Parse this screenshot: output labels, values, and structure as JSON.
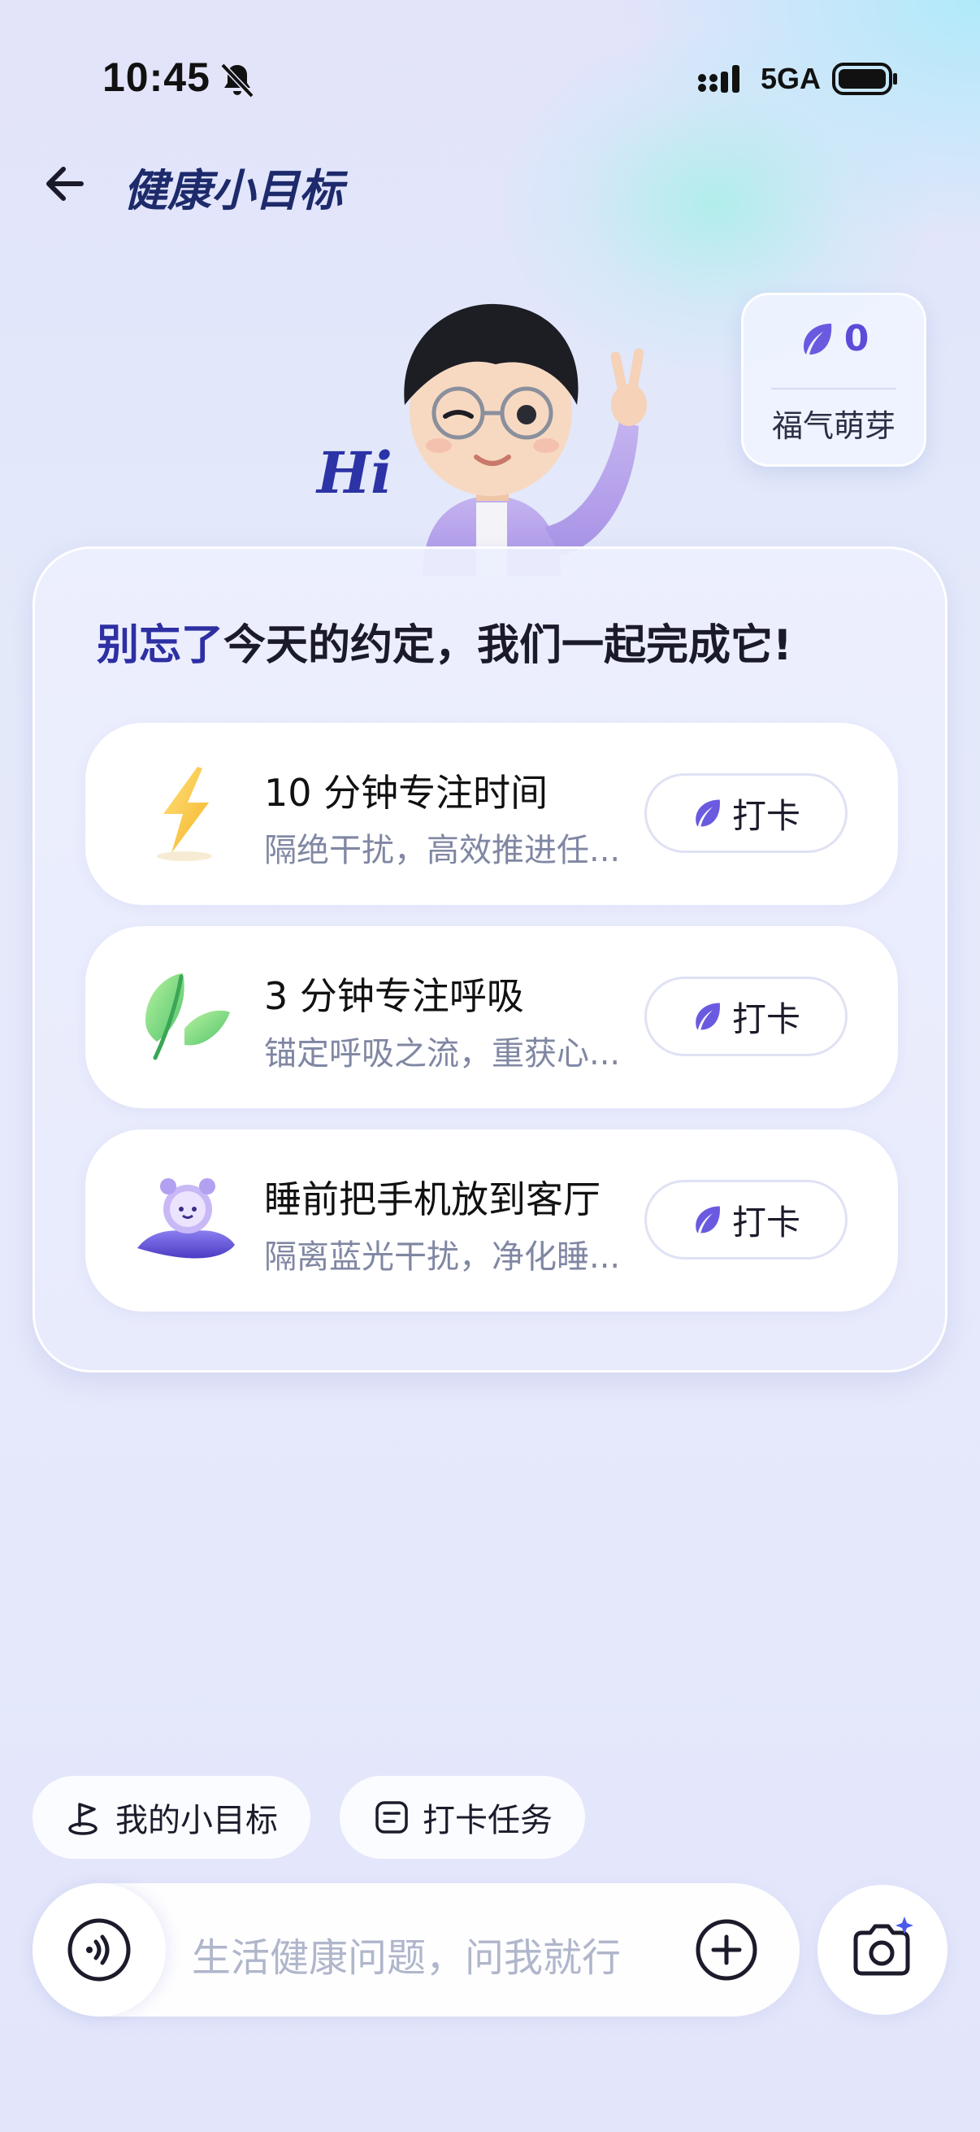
{
  "status_bar": {
    "time": "10:45",
    "network": "5GA",
    "icons": [
      "bell-muted-icon",
      "signal-icon",
      "battery-icon"
    ]
  },
  "header": {
    "title": "健康小目标",
    "back_icon": "arrow-left-icon"
  },
  "hero": {
    "hi_text": "Hi",
    "mascot": "boy-avatar-waving"
  },
  "score": {
    "value": "0",
    "label": "福气萌芽",
    "icon": "leaf-icon"
  },
  "panel": {
    "headline_accent": "别忘了",
    "headline_rest": "今天的约定，我们一起完成它!",
    "tasks": [
      {
        "title": "10 分钟专注时间",
        "desc": "隔绝干扰，高效推进任...",
        "icon": "lightning-icon",
        "button": "打卡"
      },
      {
        "title": "3 分钟专注呼吸",
        "desc": "锚定呼吸之流，重获心...",
        "icon": "green-leaf-icon",
        "button": "打卡"
      },
      {
        "title": "睡前把手机放到客厅",
        "desc": "隔离蓝光干扰，净化睡...",
        "icon": "alarm-clock-pillow-icon",
        "button": "打卡"
      }
    ]
  },
  "chips": {
    "my_goals": "我的小目标",
    "checkin_tasks": "打卡任务"
  },
  "input": {
    "placeholder": "生活健康问题，问我就行"
  },
  "colors": {
    "accent": "#5a4cd8",
    "title": "#1d2a6b",
    "muted_text": "#8087a3"
  }
}
